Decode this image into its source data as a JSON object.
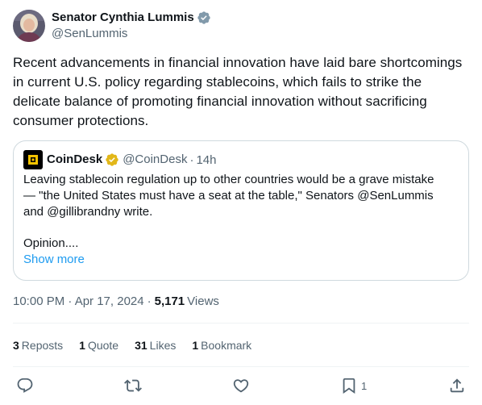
{
  "author": {
    "display_name": "Senator Cynthia Lummis",
    "handle": "@SenLummis"
  },
  "tweet": {
    "text": "Recent advancements in financial innovation have laid bare shortcomings in current U.S. policy regarding stablecoins, which fails to strike the delicate balance of promoting financial innovation without sacrificing consumer protections."
  },
  "quote": {
    "display_name": "CoinDesk",
    "handle": "@CoinDesk",
    "separator": "·",
    "time": "14h",
    "lines": [
      "Leaving stablecoin regulation up to other countries would be a grave mistake",
      "— \"the United States must have a seat at the table,\" Senators @SenLummis",
      "and @gillibrandny write."
    ],
    "tail": "Opinion....",
    "show_more": "Show more"
  },
  "meta": {
    "timestamp": "10:00 PM · Apr 17, 2024",
    "separator": "·",
    "views_count": "5,171",
    "views_label": "Views"
  },
  "stats": {
    "reposts_count": "3",
    "reposts_label": "Reposts",
    "quotes_count": "1",
    "quotes_label": "Quote",
    "likes_count": "31",
    "likes_label": "Likes",
    "bookmarks_count": "1",
    "bookmarks_label": "Bookmark"
  },
  "actions": {
    "reply_icon": "reply-icon",
    "repost_icon": "repost-icon",
    "like_icon": "heart-icon",
    "bookmark_icon": "bookmark-icon",
    "bookmark_count": "1",
    "share_icon": "share-icon"
  },
  "colors": {
    "text": "#0f1419",
    "secondary": "#536471",
    "link": "#1d9bf0",
    "verified_blue": "#1d9bf0",
    "verified_gold": "#e2b719",
    "border": "#cfd9de"
  }
}
